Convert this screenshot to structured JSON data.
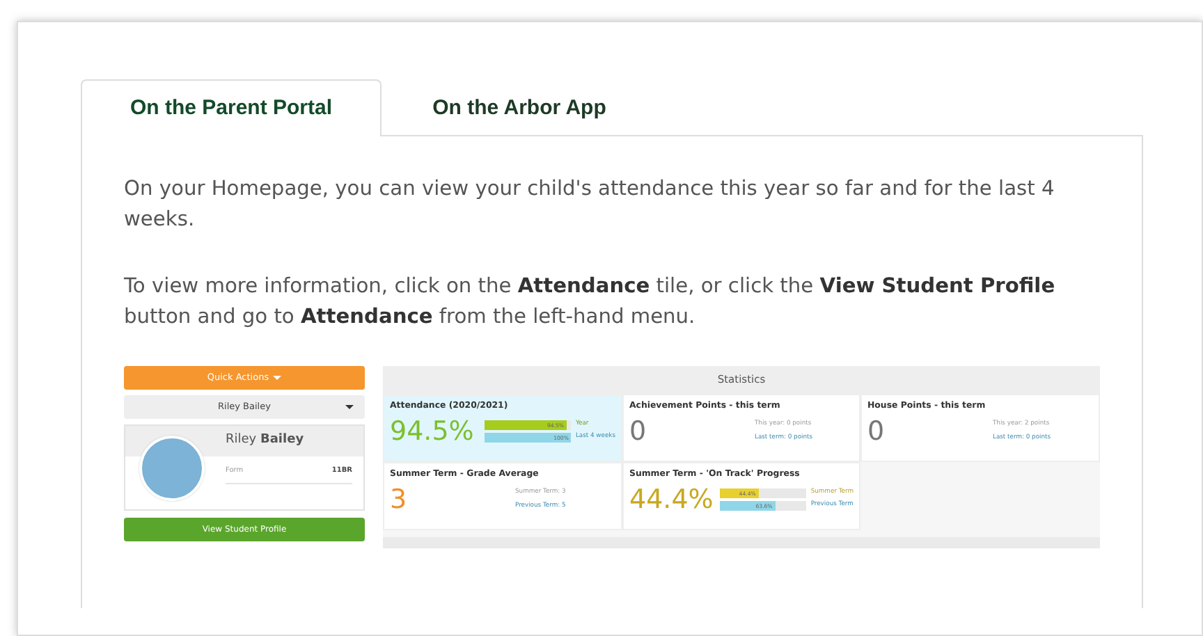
{
  "tabs": [
    {
      "label": "On the Parent Portal",
      "selected": true
    },
    {
      "label": "On the Arbor App",
      "selected": false
    }
  ],
  "paragraphs": [
    "On your Homepage, you can view your child's attendance this year so far and for the last 4 weeks.",
    "To view more information, click on the **Attendance** tile, or click the **View Student Profile** button and go to **Attendance** from the left-hand menu."
  ],
  "screenshot": {
    "quick_actions": "Quick Actions",
    "student_select": "Riley Bailey",
    "profile": {
      "name": "Riley **Bailey**",
      "field_label": "Form",
      "field_value": "11BR"
    },
    "profile_button": "View Student Profile",
    "statistics": {
      "title": "Statistics",
      "tiles": [
        {
          "kind": "bars",
          "title": "Attendance (2020/2021)",
          "value": "94.5%",
          "color": "#7cbf2e",
          "highlighted": true,
          "bars": [
            {
              "reading": "94.5%",
              "label": "Year",
              "level": 0.945,
              "color": "#a6cc1e"
            },
            {
              "reading": "100%",
              "label": "Last 4 weeks",
              "level": 1,
              "color": "#8fd6e8"
            }
          ]
        },
        {
          "kind": "notes",
          "title": "Achievement Points - this term",
          "value": "0",
          "color": "#777777",
          "highlighted": false,
          "notes": [
            {
              "text": "This year: 0 points"
            },
            {
              "text": "Last term: 0 points"
            }
          ]
        },
        {
          "kind": "notes",
          "title": "House Points - this term",
          "value": "0",
          "color": "#777777",
          "highlighted": false,
          "notes": [
            {
              "text": "This year: 2 points"
            },
            {
              "text": "Last term: 0 points"
            }
          ]
        },
        {
          "kind": "notes",
          "title": "Summer Term - Grade Average",
          "value": "3",
          "color": "#f0902a",
          "highlighted": false,
          "notes": [
            {
              "text": "Summer Term: 3"
            },
            {
              "text": "Previous Term: 5"
            }
          ]
        },
        {
          "kind": "bars",
          "title": "Summer Term - 'On Track' Progress",
          "value": "44.4%",
          "color": "#c8a820",
          "highlighted": false,
          "bars": [
            {
              "reading": "44.4%",
              "label": "Summer Term",
              "level": 0.444,
              "color": "#e8d030"
            },
            {
              "reading": "63.6%",
              "label": "Previous Term",
              "level": 0.636,
              "color": "#8fd6e8"
            }
          ]
        }
      ]
    }
  }
}
